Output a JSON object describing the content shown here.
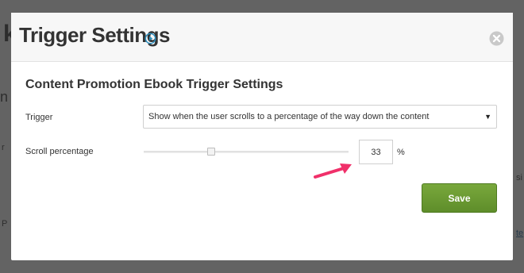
{
  "modal": {
    "title": "Trigger Settings",
    "section_title": "Content Promotion Ebook Trigger Settings",
    "trigger": {
      "label": "Trigger",
      "selected_value": "Show when the user scrolls to a percentage of the way down the content"
    },
    "scroll": {
      "label": "Scroll percentage",
      "value": "33",
      "unit": "%",
      "slider_level_percent": 33
    },
    "save_label": "Save"
  },
  "icons": {
    "play": "play-circle-icon",
    "close": "close-circle-icon",
    "annotation": "pointer-arrow-icon",
    "select_caret": "caret-down-icon"
  },
  "colors": {
    "save_button": "#6a9a33",
    "annotation_arrow": "#f0306a",
    "play_icon": "#2a8fbf",
    "close_icon": "#c9c9c9"
  }
}
